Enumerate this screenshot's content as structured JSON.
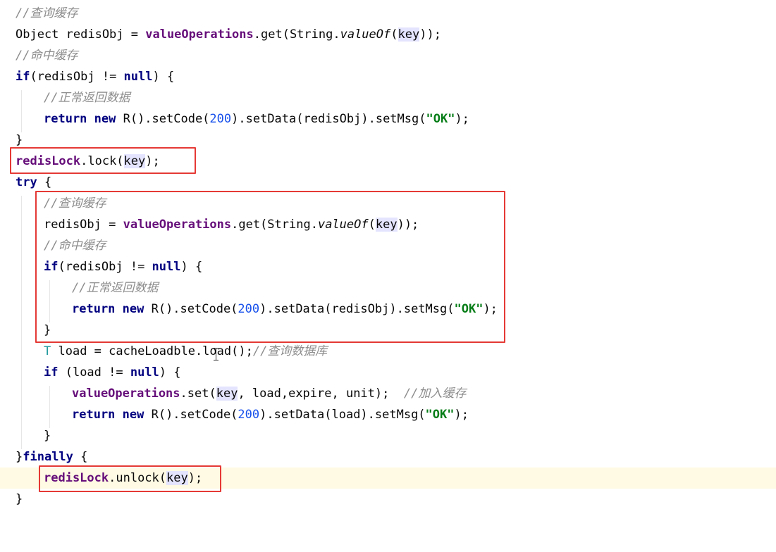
{
  "editor": {
    "lines": [
      {
        "c1": "//查询缓存"
      },
      {
        "a": "Object redisObj = ",
        "b": "valueOperations",
        "c": ".get(String.",
        "d": "valueOf",
        "e": "(",
        "f": "key",
        "g": "));"
      },
      {
        "c1": "//命中缓存"
      },
      {
        "kw": "if",
        "a": "(redisObj != ",
        "kw2": "null",
        "b": ") {"
      },
      {
        "c1": "//正常返回数据"
      },
      {
        "kw": "return new ",
        "a": "R().setCode(",
        "n": "200",
        "b": ").setData(redisObj).setMsg(",
        "s": "\"OK\"",
        "c": ");"
      },
      {
        "a": "}"
      },
      {
        "f1": "redisLock",
        "a": ".lock(",
        "k": "key",
        "b": ");"
      },
      {
        "kw": "try",
        "a": " {"
      },
      {
        "c1": "//查询缓存"
      },
      {
        "a": "redisObj = ",
        "b": "valueOperations",
        "c": ".get(String.",
        "d": "valueOf",
        "e": "(",
        "f": "key",
        "g": "));"
      },
      {
        "c1": "//命中缓存"
      },
      {
        "kw": "if",
        "a": "(redisObj != ",
        "kw2": "null",
        "b": ") {"
      },
      {
        "c1": "//正常返回数据"
      },
      {
        "kw": "return new ",
        "a": "R().setCode(",
        "n": "200",
        "b": ").setData(redisObj).setMsg(",
        "s": "\"OK\"",
        "c": ");"
      },
      {
        "a": "}"
      },
      {
        "t": "T",
        "a": " load = cacheLoadble.load();",
        "cm": "//查询数据库"
      },
      {
        "kw": "if",
        "a": " (load != ",
        "kw2": "null",
        "b": ") {"
      },
      {
        "f1": "valueOperations",
        "a": ".set(",
        "k": "key",
        "b": ", load,expire, unit);  ",
        "cm": "//加入缓存"
      },
      {
        "kw": "return new ",
        "a": "R().setCode(",
        "n": "200",
        "b": ").setData(load).setMsg(",
        "s": "\"OK\"",
        "c": ");"
      },
      {
        "a": "}"
      },
      {
        "a": "}",
        "kw": "finally",
        "b": " {"
      },
      {
        "f1": "redisLock",
        "a": ".unlock(",
        "k": "key",
        "b": ");"
      },
      {
        "a": "}"
      }
    ]
  },
  "colors": {
    "keyword": "#000080",
    "field": "#660e7a",
    "comment": "#8c8c8c",
    "number": "#1750eb",
    "string": "#067d17",
    "highlight_box": "#e53935",
    "current_line": "#fffae3"
  }
}
